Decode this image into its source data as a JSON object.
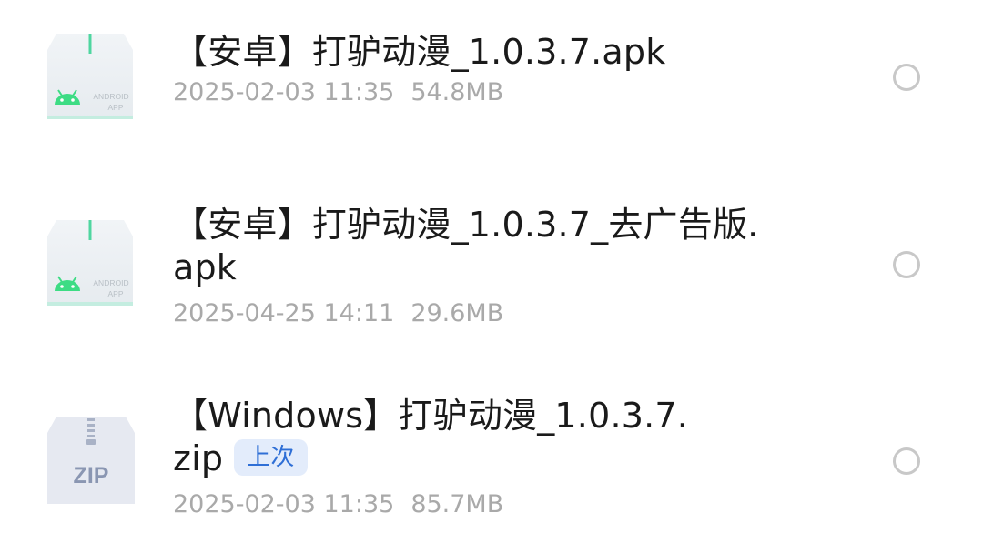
{
  "files": [
    {
      "name": "【安卓】打驴动漫_1.0.3.7.apk",
      "date": "2025-02-03 11:35",
      "size": "54.8MB",
      "icon": "android-apk-icon",
      "icon_label_1": "ANDROID",
      "icon_label_2": "APP"
    },
    {
      "name_line1": "【安卓】打驴动漫_1.0.3.7_去广告版.",
      "name_line2": "apk",
      "date": "2025-04-25 14:11",
      "size": "29.6MB",
      "icon": "android-apk-icon",
      "icon_label_1": "ANDROID",
      "icon_label_2": "APP"
    },
    {
      "name_line1": "【Windows】打驴动漫_1.0.3.7.",
      "name_line2": "zip",
      "badge": "上次",
      "date": "2025-02-03 11:35",
      "size": "85.7MB",
      "icon": "zip-archive-icon",
      "icon_label": "ZIP"
    }
  ],
  "colors": {
    "android_green": "#3ddc84",
    "badge_text": "#2f6fd6",
    "badge_bg": "#e3ecfb",
    "meta_text": "#a9a9a9"
  }
}
